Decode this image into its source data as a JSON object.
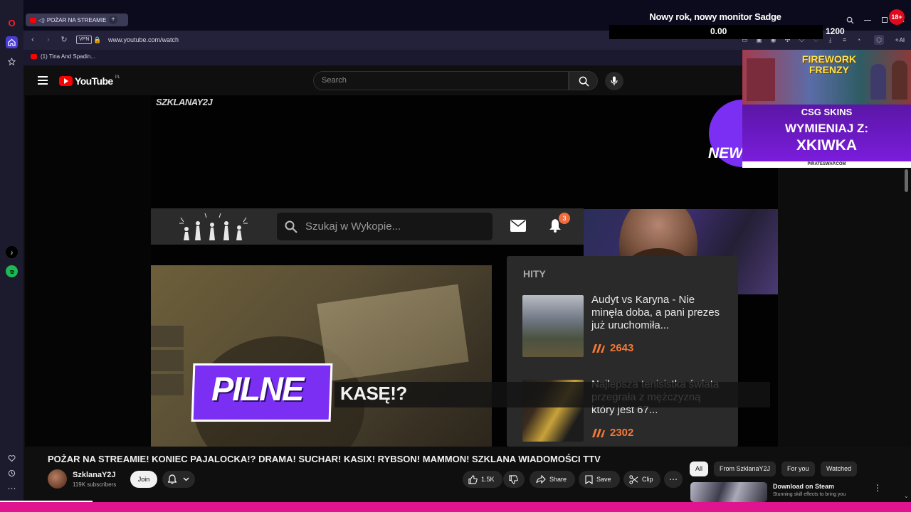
{
  "browser": {
    "tab_title": "POŻAR NA STREAMIE",
    "address": "www.youtube.com/watch",
    "vpn_label": "VPN",
    "bookmark": "(1) Tina And Spadin...",
    "extensions_label": "AI"
  },
  "overlay": {
    "title": "Nowy rok, nowy monitor Sadge",
    "current": "0.00",
    "goal": "1200",
    "progress_fraction": 0,
    "age_badge": "18+"
  },
  "youtube": {
    "logo": "YouTube",
    "region": "PL",
    "search_placeholder": "Search"
  },
  "video": {
    "watermark": "SZKLANAY2J",
    "wykop_search_placeholder": "Szukaj w Wykopie...",
    "notification_count": "3",
    "hity_title": "HITY",
    "hits": [
      {
        "title": "Audyt vs Karyna - Nie minęła doba, a pani prezes już uruchomiła...",
        "score": "2643"
      },
      {
        "title": "Najlepsza tenisistka świata przegrała z mężczyzną który jest 67...",
        "score": "2302"
      }
    ],
    "pilne": "PILNE",
    "ticker": "KASĘ!?",
    "new_text": "NEW",
    "ad": {
      "game_title": "FIREWORK FRENZY",
      "brand": "CSG SKINS",
      "line1": "WYMIENIAJ Z:",
      "line2": "XKIWKA",
      "footer": "PIRATESWAP.COM"
    }
  },
  "watch": {
    "title": "POŻAR NA STREAMIE! KONIEC PAJALOCKA!? DRAMA! SUCHAR! KASIX! RYBSON! MAMMON! SZKLANA WIADOMOŚCI TTV",
    "channel_name": "SzklanaY2J",
    "subscribers": "119K subscribers",
    "join": "Join",
    "likes": "1.5K",
    "share": "Share",
    "save": "Save",
    "clip": "Clip"
  },
  "recommendations": {
    "chips": [
      "All",
      "From SzklanaY2J",
      "For you",
      "Watched"
    ],
    "first": {
      "title": "Download on Steam",
      "subtitle": "Stunning skill effects to bring you"
    }
  },
  "colors": {
    "accent_purple": "#7a2ff2",
    "wykop_orange": "#f37839",
    "youtube_red": "#ff0000",
    "bottom_bar": "#e1148f"
  }
}
